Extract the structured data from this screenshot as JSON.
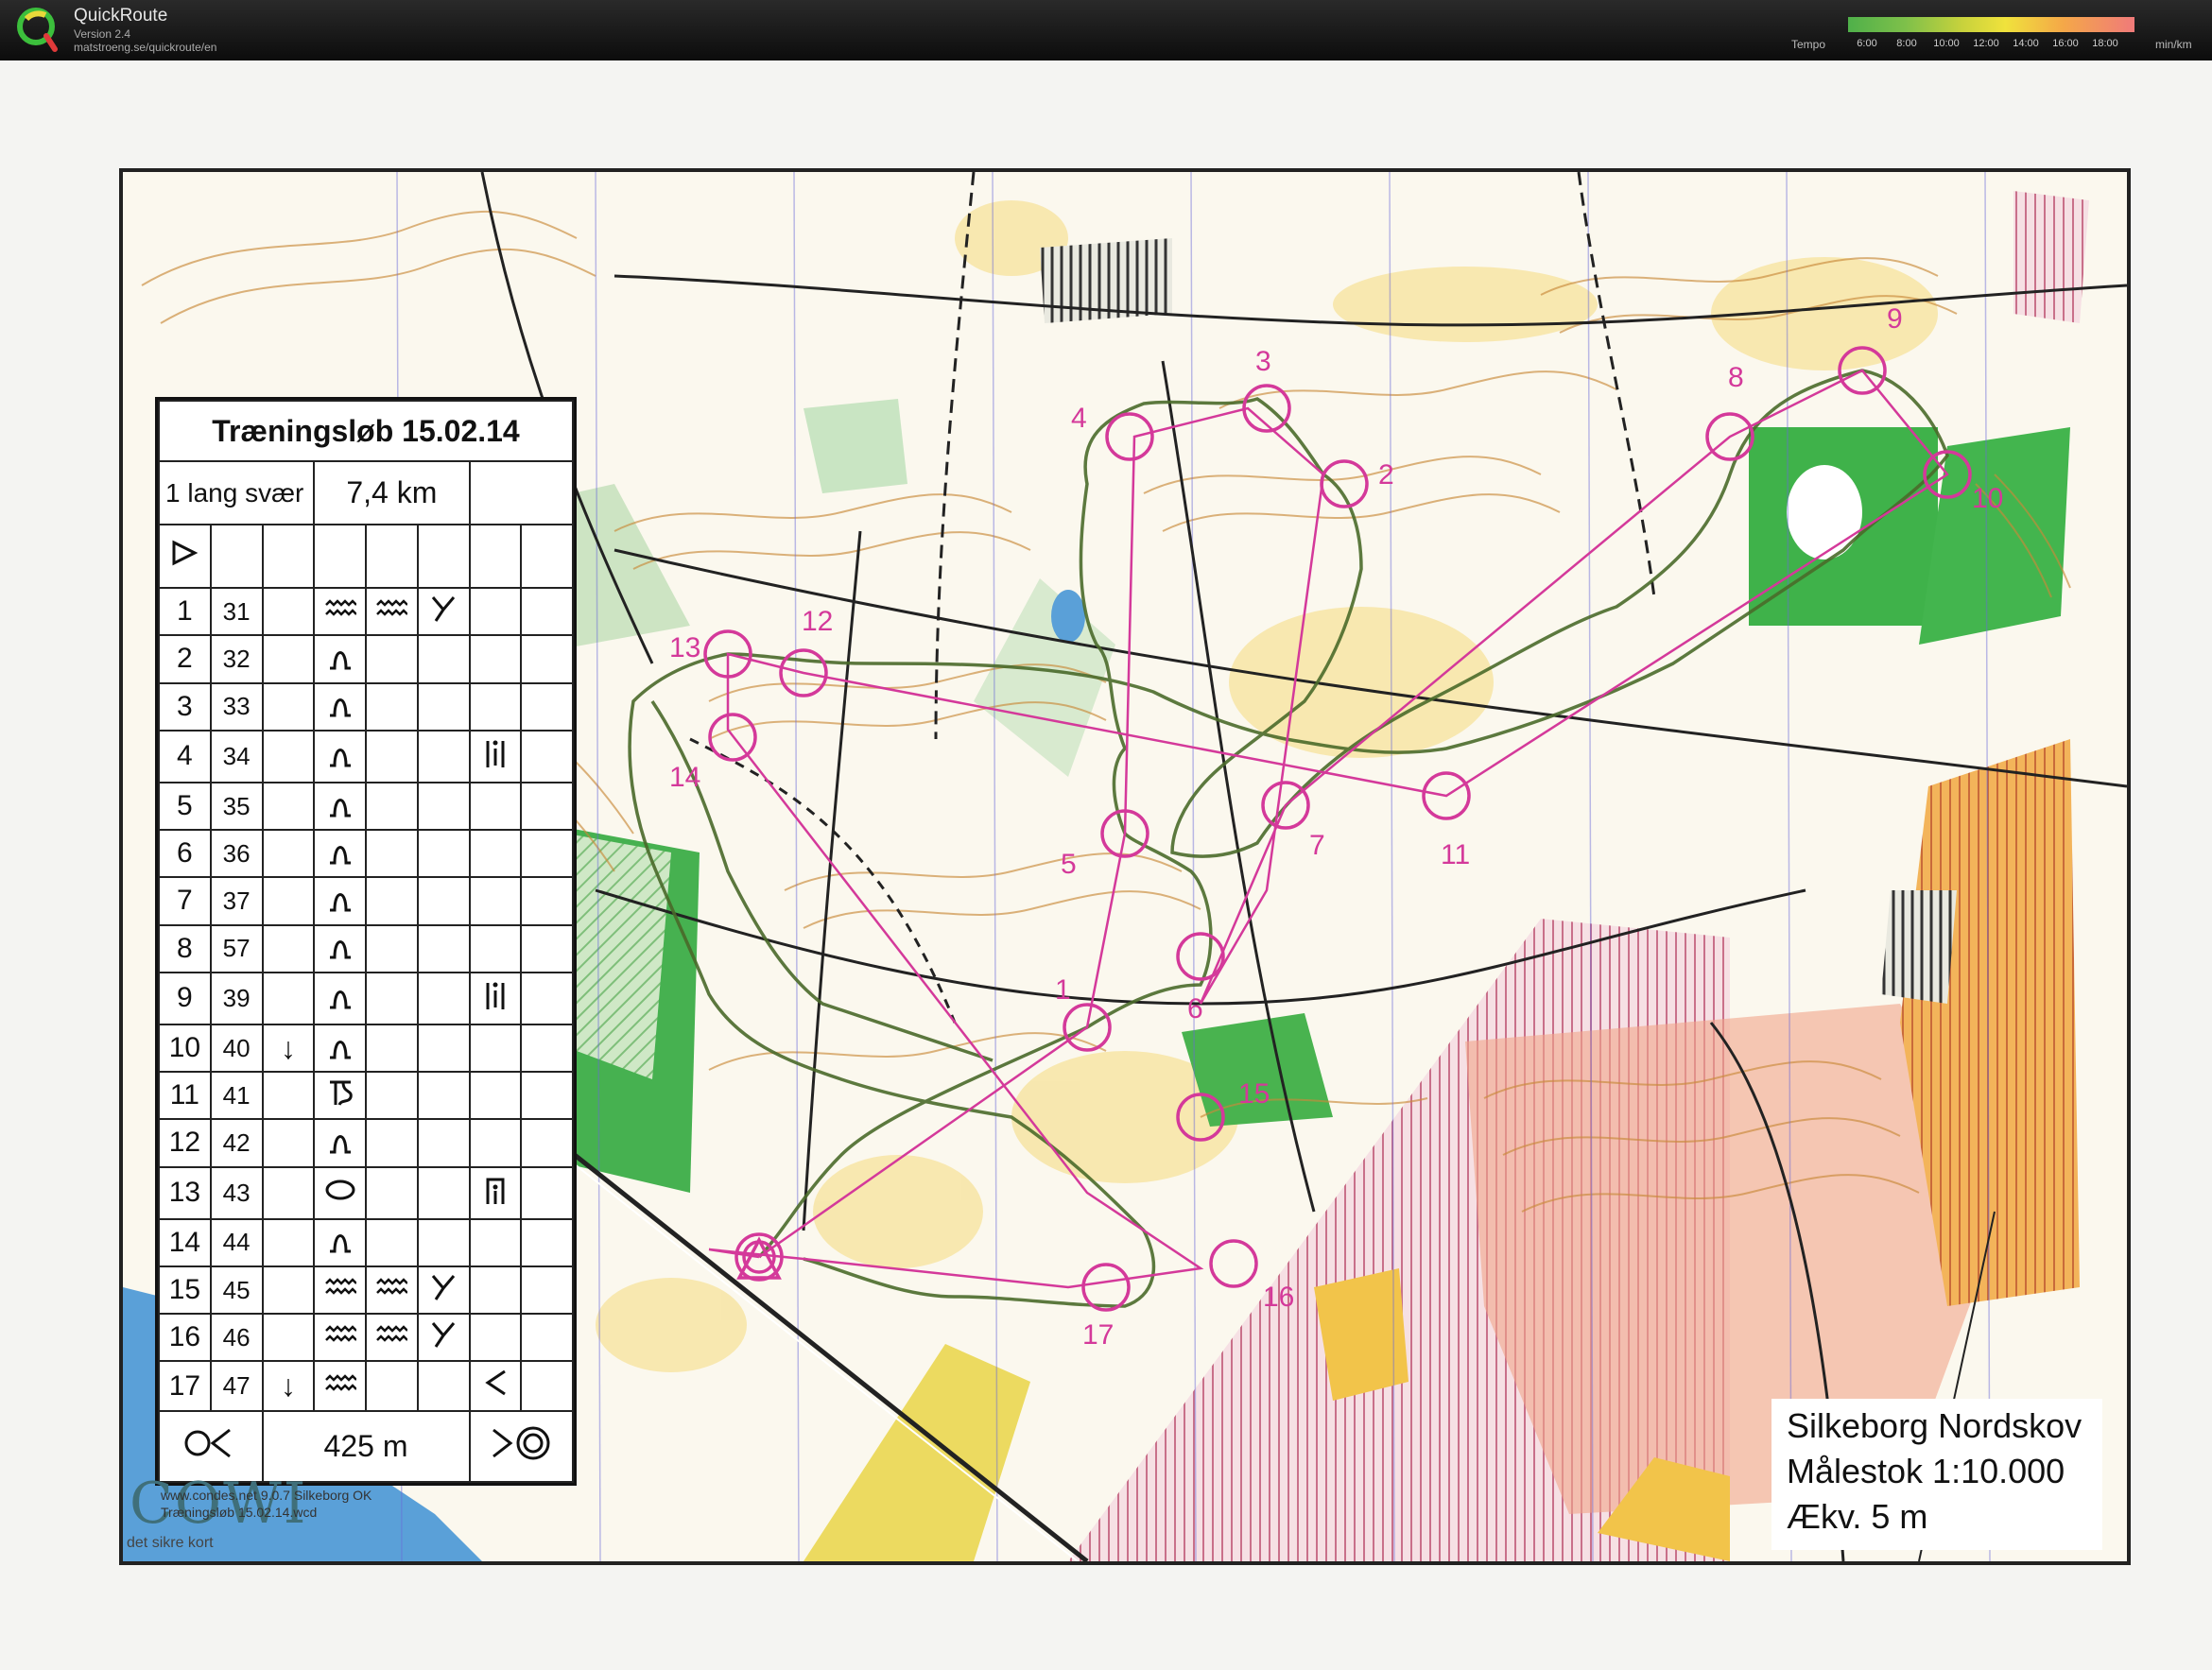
{
  "app": {
    "title": "QuickRoute",
    "version": "Version 2.4",
    "url": "matstroeng.se/quickroute/en",
    "logo_letter": "Q"
  },
  "tempo_legend": {
    "label": "Tempo",
    "unit": "min/km",
    "ticks": [
      "6:00",
      "8:00",
      "10:00",
      "12:00",
      "14:00",
      "16:00",
      "18:00"
    ]
  },
  "map": {
    "event_title": "Træningsløb 15.02.14",
    "course_name": "1 lang svær",
    "course_length": "7,4 km",
    "finish_distance": "425 m",
    "area_name": "Silkeborg Nordskov",
    "scale": "Målestok 1:10.000",
    "contour_interval": "Ækv. 5 m",
    "credit_line_1": "www.condes.net 9.0.7 Silkeborg OK",
    "credit_line_2": "Træningsløb 15.02.14.wcd",
    "publisher": "COWI",
    "publisher_tagline": "det sikre kort",
    "colors": {
      "course": "#d4399a",
      "route": "#4a6a2a",
      "forest_green": "#3fb24a",
      "open_yellow": "#f7e28a",
      "contour": "#c98a3a",
      "water": "#5aa0d8"
    }
  },
  "controls": [
    {
      "number": "1",
      "code": "31",
      "sym_c": "",
      "sym_d": "wavy",
      "sym_e": "wavy",
      "sym_f": "fork",
      "sym_g": ""
    },
    {
      "number": "2",
      "code": "32",
      "sym_c": "",
      "sym_d": "knoll",
      "sym_e": "",
      "sym_f": "",
      "sym_g": ""
    },
    {
      "number": "3",
      "code": "33",
      "sym_c": "",
      "sym_d": "knoll",
      "sym_e": "",
      "sym_f": "",
      "sym_g": ""
    },
    {
      "number": "4",
      "code": "34",
      "sym_c": "",
      "sym_d": "knoll",
      "sym_e": "",
      "sym_f": "",
      "sym_g": "bar"
    },
    {
      "number": "5",
      "code": "35",
      "sym_c": "",
      "sym_d": "knoll",
      "sym_e": "",
      "sym_f": "",
      "sym_g": ""
    },
    {
      "number": "6",
      "code": "36",
      "sym_c": "",
      "sym_d": "knoll",
      "sym_e": "",
      "sym_f": "",
      "sym_g": ""
    },
    {
      "number": "7",
      "code": "37",
      "sym_c": "",
      "sym_d": "knoll",
      "sym_e": "",
      "sym_f": "",
      "sym_g": ""
    },
    {
      "number": "8",
      "code": "57",
      "sym_c": "",
      "sym_d": "knoll",
      "sym_e": "",
      "sym_f": "",
      "sym_g": ""
    },
    {
      "number": "9",
      "code": "39",
      "sym_c": "",
      "sym_d": "knoll",
      "sym_e": "",
      "sym_f": "",
      "sym_g": "bar"
    },
    {
      "number": "10",
      "code": "40",
      "sym_c": "↓",
      "sym_d": "knoll",
      "sym_e": "",
      "sym_f": "",
      "sym_g": ""
    },
    {
      "number": "11",
      "code": "41",
      "sym_c": "",
      "sym_d": "spur",
      "sym_e": "",
      "sym_f": "",
      "sym_g": ""
    },
    {
      "number": "12",
      "code": "42",
      "sym_c": "",
      "sym_d": "knoll",
      "sym_e": "",
      "sym_f": "",
      "sym_g": ""
    },
    {
      "number": "13",
      "code": "43",
      "sym_c": "",
      "sym_d": "oval",
      "sym_e": "",
      "sym_f": "",
      "sym_g": "top"
    },
    {
      "number": "14",
      "code": "44",
      "sym_c": "",
      "sym_d": "knoll",
      "sym_e": "",
      "sym_f": "",
      "sym_g": ""
    },
    {
      "number": "15",
      "code": "45",
      "sym_c": "",
      "sym_d": "wavy",
      "sym_e": "wavy",
      "sym_f": "fork",
      "sym_g": ""
    },
    {
      "number": "16",
      "code": "46",
      "sym_c": "",
      "sym_d": "wavy",
      "sym_e": "wavy",
      "sym_f": "fork",
      "sym_g": ""
    },
    {
      "number": "17",
      "code": "47",
      "sym_c": "↓",
      "sym_d": "wavy",
      "sym_e": "",
      "sym_f": "",
      "sym_g": "angle"
    }
  ],
  "map_labels": [
    "1",
    "2",
    "3",
    "4",
    "5",
    "6",
    "7",
    "8",
    "9",
    "10",
    "11",
    "12",
    "13",
    "14",
    "15",
    "16",
    "17"
  ]
}
